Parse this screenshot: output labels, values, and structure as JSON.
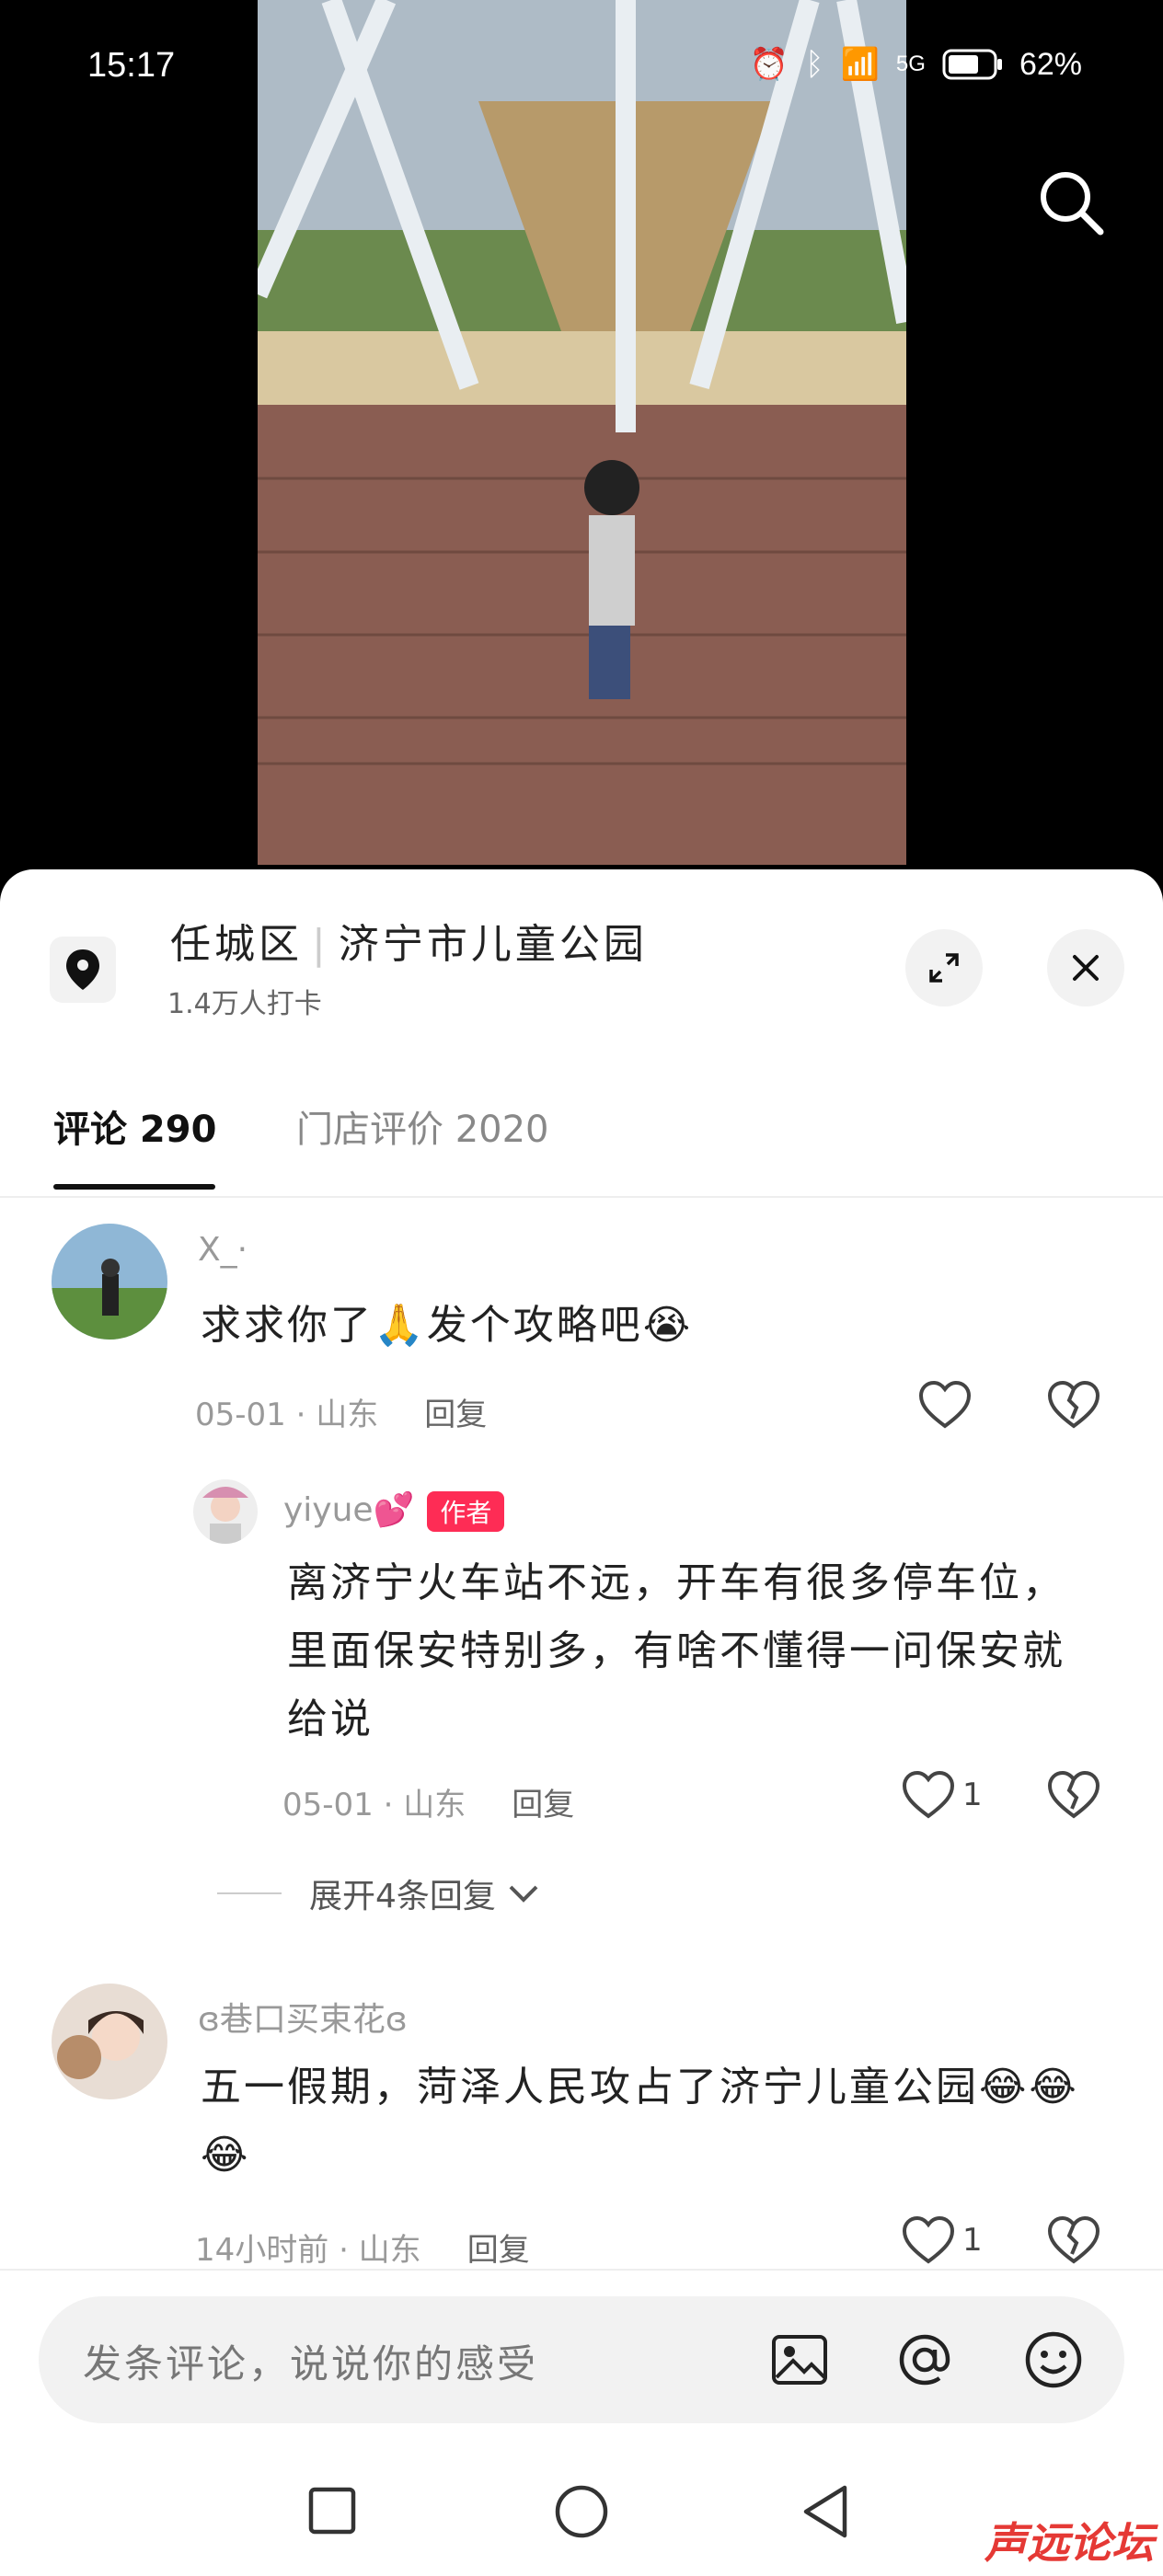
{
  "status_bar": {
    "time": "15:17",
    "battery": "62%",
    "network": "5G"
  },
  "location": {
    "district": "任城区",
    "name": "济宁市儿童公园",
    "checkins": "1.4万人打卡"
  },
  "tabs": [
    {
      "label": "评论 290"
    },
    {
      "label": "门店评价 2020"
    }
  ],
  "comments": [
    {
      "user": "X_·",
      "text": "求求你了🙏发个攻略吧😭",
      "meta": "05-01 · 山东",
      "reply_label": "回复",
      "likes": ""
    },
    {
      "user": "yiyue💕",
      "badge": "作者",
      "text": "离济宁火车站不远，开车有很多停车位，里面保安特别多，有啥不懂得一问保安就给说",
      "meta": "05-01 · 山东",
      "reply_label": "回复",
      "likes": "1"
    },
    {
      "user": "ɞ巷口买束花ɞ",
      "text": "五一假期，菏泽人民攻占了济宁儿童公园😂😂😂",
      "meta": "14小时前 · 山东",
      "reply_label": "回复",
      "likes": "1"
    }
  ],
  "expand_replies": "展开4条回复",
  "input": {
    "placeholder": "发条评论，说说你的感受"
  },
  "watermark": "声远论坛"
}
